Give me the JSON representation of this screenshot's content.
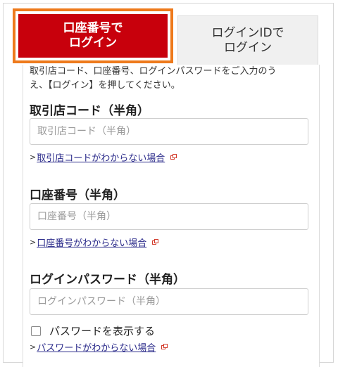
{
  "tabs": {
    "active": {
      "line1": "口座番号で",
      "line2": "ログイン"
    },
    "inactive": {
      "line1": "ログインIDで",
      "line2": "ログイン"
    }
  },
  "intro": {
    "line1": "取引店コード、口座番号、ログインパスワードをご入力のう",
    "line2": "え、【ログイン】を押してください。"
  },
  "fields": [
    {
      "label": "取引店コード（半角）",
      "placeholder": "取引店コード（半角）",
      "help": "取引店コードがわからない場合"
    },
    {
      "label": "口座番号（半角）",
      "placeholder": "口座番号（半角）",
      "help": "口座番号がわからない場合"
    },
    {
      "label": "ログインパスワード（半角）",
      "placeholder": "ログインパスワード（半角）",
      "help": "パスワードがわからない場合"
    }
  ],
  "show_password": {
    "label": "パスワードを表示する",
    "checked": false
  },
  "help_prefix": ">",
  "colors": {
    "active_tab": "#c8000c",
    "highlight_border": "#ee7a1c",
    "external_icon": "#d23a2a"
  }
}
